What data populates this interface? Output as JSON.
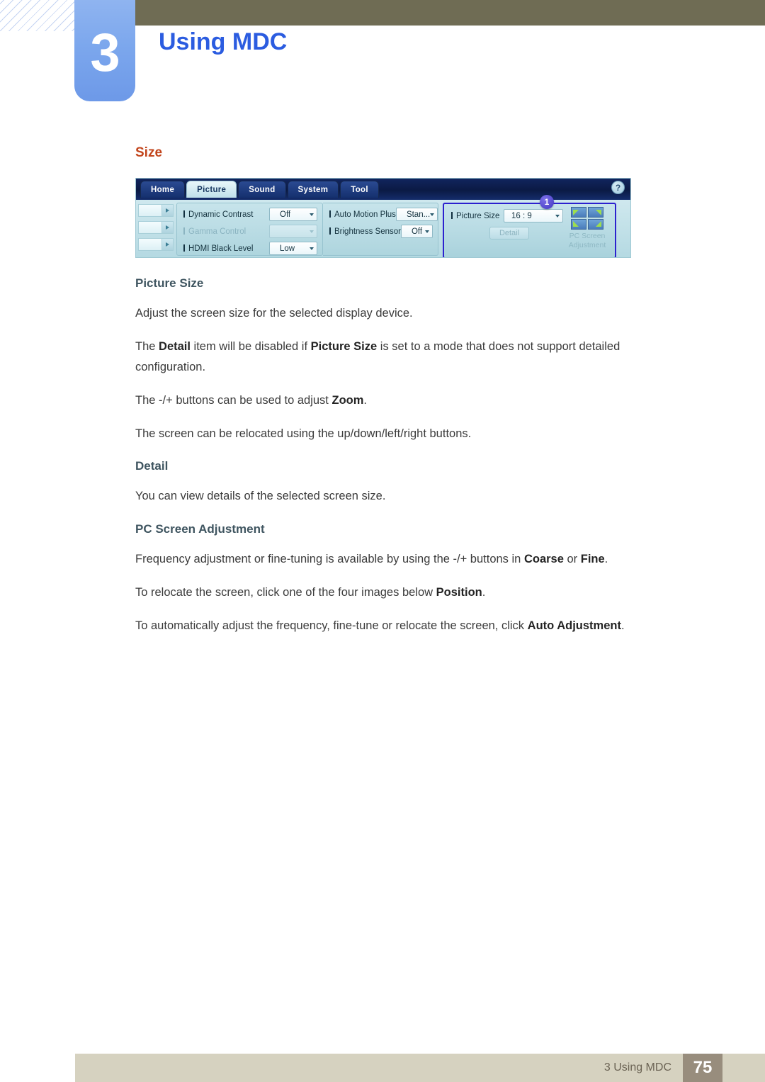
{
  "header": {
    "chapter_number": "3",
    "chapter_title": "Using MDC"
  },
  "content": {
    "section_heading": "Size",
    "blocks": [
      {
        "heading": "Picture Size"
      },
      {
        "text_1": "Adjust the screen size for the selected display device."
      },
      {
        "text_2_a": "The ",
        "text_2_b": "Detail",
        "text_2_c": " item will be disabled if ",
        "text_2_d": "Picture Size",
        "text_2_e": " is set to a mode that does not support detailed configuration."
      },
      {
        "text_3_a": "The -/+ buttons can be used to adjust ",
        "text_3_b": "Zoom",
        "text_3_c": "."
      },
      {
        "text_4": "The screen can be relocated using the up/down/left/right buttons."
      },
      {
        "heading_2": "Detail"
      },
      {
        "text_5": "You can view details of the selected screen size."
      },
      {
        "heading_3": "PC Screen Adjustment"
      },
      {
        "text_6_a": "Frequency adjustment or fine-tuning is available by using the -/+ buttons in ",
        "text_6_b": "Coarse",
        "text_6_c": " or ",
        "text_6_d": "Fine",
        "text_6_e": "."
      },
      {
        "text_7_a": "To relocate the screen, click one of the four images below ",
        "text_7_b": "Position",
        "text_7_c": "."
      },
      {
        "text_8_a": "To automatically adjust the frequency, fine-tune or relocate the screen, click ",
        "text_8_b": "Auto Adjustment",
        "text_8_c": "."
      }
    ]
  },
  "mdc_screenshot": {
    "tabs": [
      {
        "label": "Home",
        "active": false
      },
      {
        "label": "Picture",
        "active": true
      },
      {
        "label": "Sound",
        "active": false
      },
      {
        "label": "System",
        "active": false
      },
      {
        "label": "Tool",
        "active": false
      }
    ],
    "help_button": "?",
    "group_left": [
      {
        "label": "Dynamic Contrast",
        "value": "Off",
        "disabled": false
      },
      {
        "label": "Gamma Control",
        "value": "",
        "disabled": true
      },
      {
        "label": "HDMI Black Level",
        "value": "Low",
        "disabled": false
      }
    ],
    "group_middle": [
      {
        "label": "Auto Motion Plus",
        "value": "Stan...",
        "disabled": false
      },
      {
        "label": "Brightness Sensor",
        "value": "Off",
        "disabled": false
      }
    ],
    "highlight_panel": {
      "callout_badge": "1",
      "picture_size_label": "Picture Size",
      "picture_size_value": "16 : 9",
      "detail_button": "Detail",
      "pc_screen_adjustment_label_line1": "PC Screen",
      "pc_screen_adjustment_label_line2": "Adjustment",
      "highlight_color": "#2c21cf"
    }
  },
  "footer": {
    "label": "3 Using MDC",
    "page_number": "75"
  }
}
